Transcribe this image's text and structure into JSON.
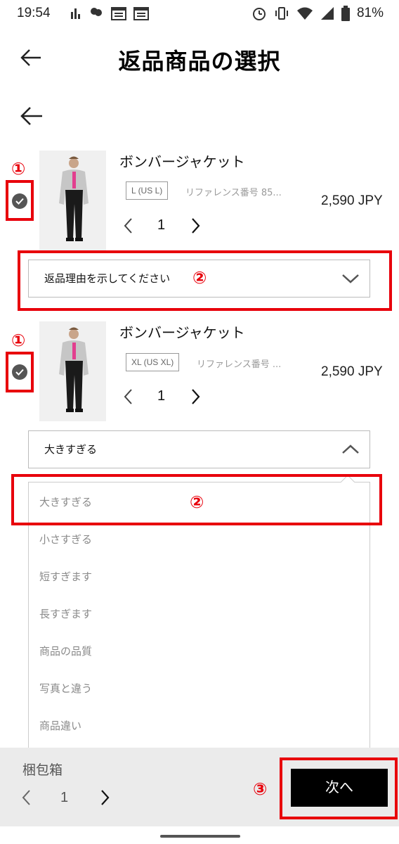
{
  "status_bar": {
    "time": "19:54",
    "battery": "81%"
  },
  "header": {
    "title": "返品商品の選択"
  },
  "annotations": {
    "mark_1": "①",
    "mark_2": "②",
    "mark_3": "③"
  },
  "items": [
    {
      "name": "ボンバージャケット",
      "size": "L (US L)",
      "reference": "リファレンス番号 85...",
      "price": "2,590 JPY",
      "quantity": "1",
      "reason": "返品理由を示してください"
    },
    {
      "name": "ボンバージャケット",
      "size": "XL (US XL)",
      "reference": "リファレンス番号 ...",
      "price": "2,590 JPY",
      "quantity": "1",
      "reason": "大きすぎる"
    }
  ],
  "reason_options": [
    "大きすぎる",
    "小さすぎる",
    "短すぎます",
    "長すぎます",
    "商品の品質",
    "写真と違う",
    "商品違い"
  ],
  "footer": {
    "package_label": "梱包箱",
    "package_quantity": "1",
    "next_label": "次へ"
  },
  "colors": {
    "annotation_red": "#e8000b",
    "button_black": "#000000",
    "footer_bg": "#ebebeb"
  }
}
